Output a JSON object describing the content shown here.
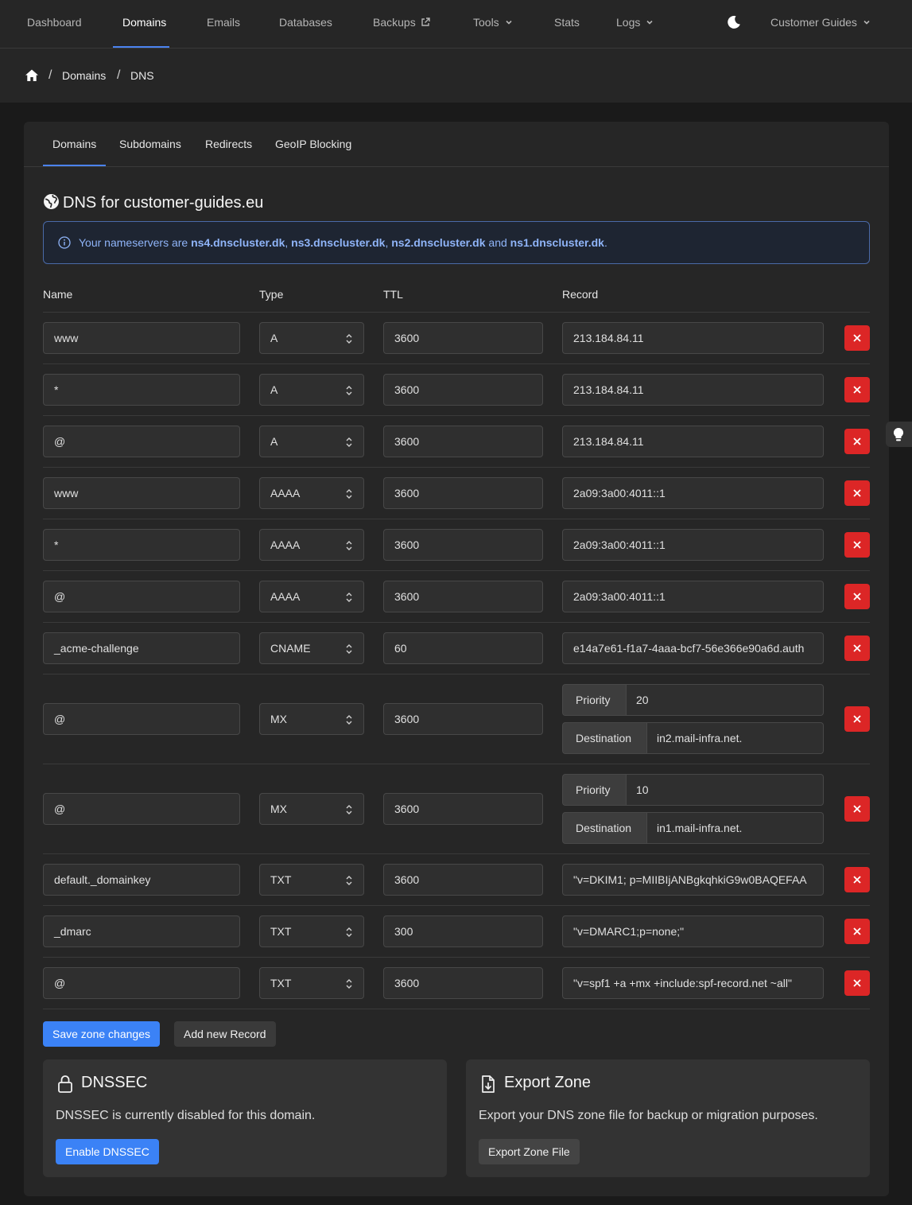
{
  "nav": {
    "items": [
      "Dashboard",
      "Domains",
      "Emails",
      "Databases",
      "Backups",
      "Tools",
      "Stats",
      "Logs"
    ],
    "active": "Domains",
    "account": "Customer Guides"
  },
  "breadcrumb": {
    "items": [
      "Domains",
      "DNS"
    ]
  },
  "subtabs": {
    "items": [
      "Domains",
      "Subdomains",
      "Redirects",
      "GeoIP Blocking"
    ],
    "active": "Domains"
  },
  "page": {
    "title": "DNS for customer-guides.eu"
  },
  "alert": {
    "prefix": "Your nameservers are ",
    "ns": [
      "ns4.dnscluster.dk",
      "ns3.dnscluster.dk",
      "ns2.dnscluster.dk",
      "ns1.dnscluster.dk"
    ],
    "sep1": ", ",
    "sep2": ", ",
    "and": " and ",
    "suffix": "."
  },
  "table": {
    "headers": {
      "name": "Name",
      "type": "Type",
      "ttl": "TTL",
      "record": "Record"
    },
    "rows": [
      {
        "name": "www",
        "type": "A",
        "ttl": "3600",
        "record": "213.184.84.11"
      },
      {
        "name": "*",
        "type": "A",
        "ttl": "3600",
        "record": "213.184.84.11"
      },
      {
        "name": "@",
        "type": "A",
        "ttl": "3600",
        "record": "213.184.84.11"
      },
      {
        "name": "www",
        "type": "AAAA",
        "ttl": "3600",
        "record": "2a09:3a00:4011::1"
      },
      {
        "name": "*",
        "type": "AAAA",
        "ttl": "3600",
        "record": "2a09:3a00:4011::1"
      },
      {
        "name": "@",
        "type": "AAAA",
        "ttl": "3600",
        "record": "2a09:3a00:4011::1"
      },
      {
        "name": "_acme-challenge",
        "type": "CNAME",
        "ttl": "60",
        "record": "e14a7e61-f1a7-4aaa-bcf7-56e366e90a6d.auth"
      },
      {
        "name": "@",
        "type": "MX",
        "ttl": "3600",
        "priority_label": "Priority",
        "priority": "20",
        "destination_label": "Destination",
        "destination": "in2.mail-infra.net."
      },
      {
        "name": "@",
        "type": "MX",
        "ttl": "3600",
        "priority_label": "Priority",
        "priority": "10",
        "destination_label": "Destination",
        "destination": "in1.mail-infra.net."
      },
      {
        "name": "default._domainkey",
        "type": "TXT",
        "ttl": "3600",
        "record": "\"v=DKIM1; p=MIIBIjANBgkqhkiG9w0BAQEFAA"
      },
      {
        "name": "_dmarc",
        "type": "TXT",
        "ttl": "300",
        "record": "\"v=DMARC1;p=none;\""
      },
      {
        "name": "@",
        "type": "TXT",
        "ttl": "3600",
        "record": "\"v=spf1 +a +mx +include:spf-record.net ~all\""
      }
    ]
  },
  "actions": {
    "save": "Save zone changes",
    "add": "Add new Record"
  },
  "dnssec": {
    "title": "DNSSEC",
    "desc": "DNSSEC is currently disabled for this domain.",
    "button": "Enable DNSSEC"
  },
  "export": {
    "title": "Export Zone",
    "desc": "Export your DNS zone file for backup or migration purposes.",
    "button": "Export Zone File"
  },
  "colors": {
    "accent": "#3b82f6",
    "danger": "#dc2626",
    "info_text": "#8fb4f8"
  }
}
